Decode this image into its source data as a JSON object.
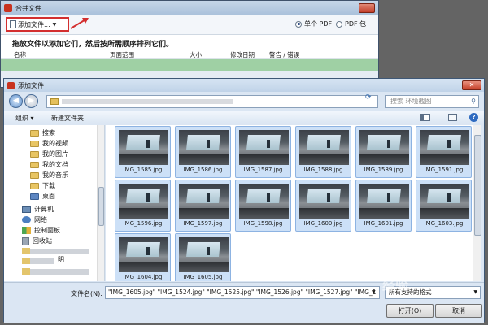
{
  "background_window": {
    "title": "合并文件",
    "add_files_label": "添加文件...",
    "output_single": "单个 PDF",
    "output_package": "PDF 包",
    "drop_hint": "拖放文件以添加它们，然后按所需顺序排列它们。",
    "columns": [
      "名称",
      "页面范围",
      "大小",
      "修改日期",
      "警告 / 错误"
    ]
  },
  "dialog": {
    "title": "添加文件",
    "search_placeholder": "搜索 环境截图",
    "organize_label": "组织 ▾",
    "new_folder_label": "新建文件夹",
    "nav_items": [
      {
        "label": "搜索",
        "icon": "folder-icon"
      },
      {
        "label": "我的视频",
        "icon": "folder-icon"
      },
      {
        "label": "我的图片",
        "icon": "folder-icon"
      },
      {
        "label": "我的文档",
        "icon": "folder-icon"
      },
      {
        "label": "我的音乐",
        "icon": "folder-icon"
      },
      {
        "label": "下载",
        "icon": "folder-icon"
      },
      {
        "label": "桌面",
        "icon": "folder-icon"
      },
      {
        "label": "计算机",
        "icon": "computer-icon"
      },
      {
        "label": "网络",
        "icon": "network-icon"
      },
      {
        "label": "控制面板",
        "icon": "control-panel-icon"
      },
      {
        "label": "回收站",
        "icon": "recycle-bin-icon"
      },
      {
        "label": "明",
        "icon": "folder-icon"
      }
    ],
    "files": [
      "IMG_1585.jpg",
      "IMG_1586.jpg",
      "IMG_1587.jpg",
      "IMG_1588.jpg",
      "IMG_1589.jpg",
      "IMG_1591.jpg",
      "IMG_1596.jpg",
      "IMG_1597.jpg",
      "IMG_1598.jpg",
      "IMG_1600.jpg",
      "IMG_1601.jpg",
      "IMG_1603.jpg",
      "IMG_1604.jpg",
      "IMG_1605.jpg"
    ],
    "filename_label": "文件名(N):",
    "filename_value": "\"IMG_1605.jpg\" \"IMG_1524.jpg\" \"IMG_1525.jpg\" \"IMG_1526.jpg\" \"IMG_1527.jpg\" \"IMG_1",
    "filetype_value": "所有支持的格式",
    "open_label": "打开(O)",
    "cancel_label": "取消"
  },
  "watermark": "经验"
}
